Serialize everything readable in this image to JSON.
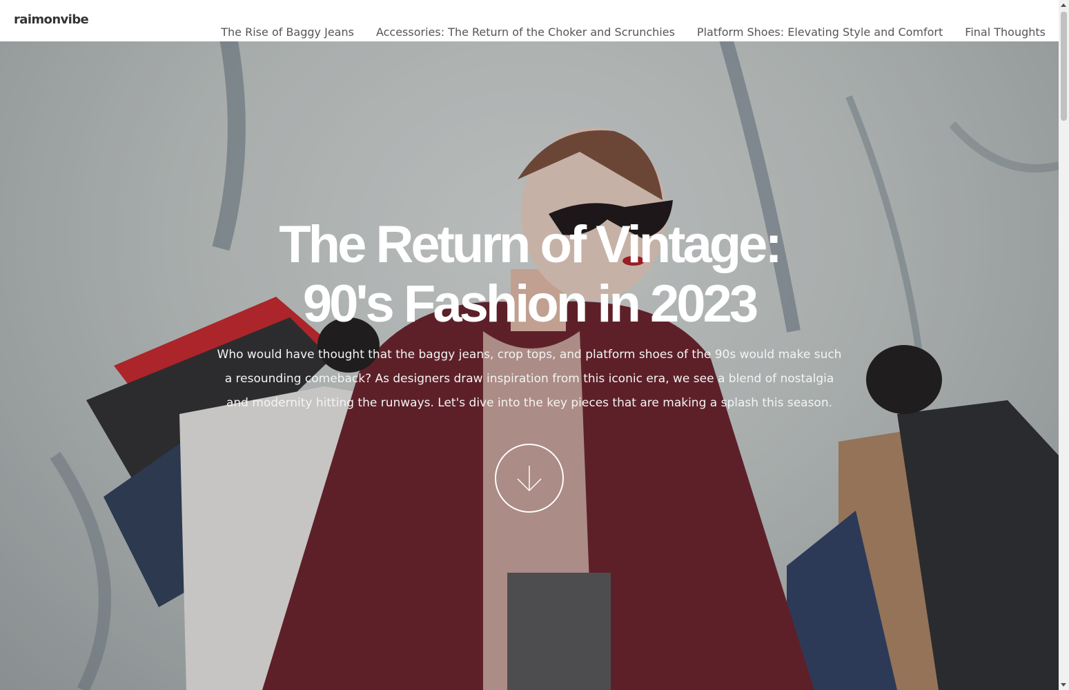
{
  "header": {
    "brand": "raimonvibe",
    "nav": [
      {
        "label": "The Rise of Baggy Jeans"
      },
      {
        "label": "Accessories: The Return of the Choker and Scrunchies"
      },
      {
        "label": "Platform Shoes: Elevating Style and Comfort"
      },
      {
        "label": "Final Thoughts"
      }
    ]
  },
  "hero": {
    "title_line1": "The Return of Vintage:",
    "title_line2": "90's Fashion in 2023",
    "description": "Who would have thought that the baggy jeans, crop tops, and platform shoes of the 90s would make such a resounding comeback? As designers draw inspiration from this iconic era, we see a blend of nostalgia and modernity hitting the runways. Let's dive into the key pieces that are making a splash this season.",
    "scroll_icon": "arrow-down-icon"
  }
}
